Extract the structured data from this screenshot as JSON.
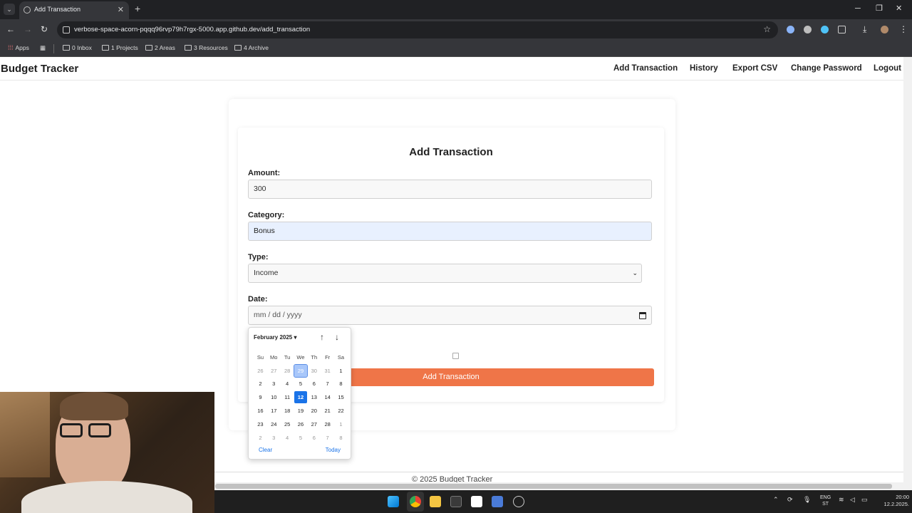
{
  "browser": {
    "tab_title": "Add Transaction",
    "url": "verbose-space-acorn-pqqq96rvp79h7rgx-5000.app.github.dev/add_transaction",
    "bookmarks": [
      "Apps",
      "0 Inbox",
      "1 Projects",
      "2 Areas",
      "3 Resources",
      "4 Archive"
    ]
  },
  "nav": {
    "brand": "Budget Tracker",
    "links": [
      "Add Transaction",
      "History",
      "Export CSV",
      "Change Password",
      "Logout"
    ]
  },
  "form": {
    "title": "Add Transaction",
    "amount_label": "Amount:",
    "amount_value": "300",
    "category_label": "Category:",
    "category_value": "Bonus",
    "type_label": "Type:",
    "type_value": "Income",
    "date_label": "Date:",
    "date_placeholder": "mm / dd / yyyy",
    "submit_label": "Add Transaction"
  },
  "datepicker": {
    "month_label": "February 2025 ▾",
    "weekdays": [
      "Su",
      "Mo",
      "Tu",
      "We",
      "Th",
      "Fr",
      "Sa"
    ],
    "weeks": [
      [
        "26",
        "27",
        "28",
        "29",
        "30",
        "31",
        "1"
      ],
      [
        "2",
        "3",
        "4",
        "5",
        "6",
        "7",
        "8"
      ],
      [
        "9",
        "10",
        "11",
        "12",
        "13",
        "14",
        "15"
      ],
      [
        "16",
        "17",
        "18",
        "19",
        "20",
        "21",
        "22"
      ],
      [
        "23",
        "24",
        "25",
        "26",
        "27",
        "28",
        "1"
      ],
      [
        "2",
        "3",
        "4",
        "5",
        "6",
        "7",
        "8"
      ]
    ],
    "clear_label": "Clear",
    "today_label": "Today"
  },
  "footer": {
    "text": "© 2025 Budget Tracker"
  },
  "taskbar": {
    "lang_top": "ENG",
    "lang_bottom": "ST",
    "time": "20:00",
    "date": "12.2.2025."
  },
  "colors": {
    "accent_button": "#ef7548",
    "today_highlight": "#1a73e8",
    "autofill_bg": "#e8f0fe"
  }
}
